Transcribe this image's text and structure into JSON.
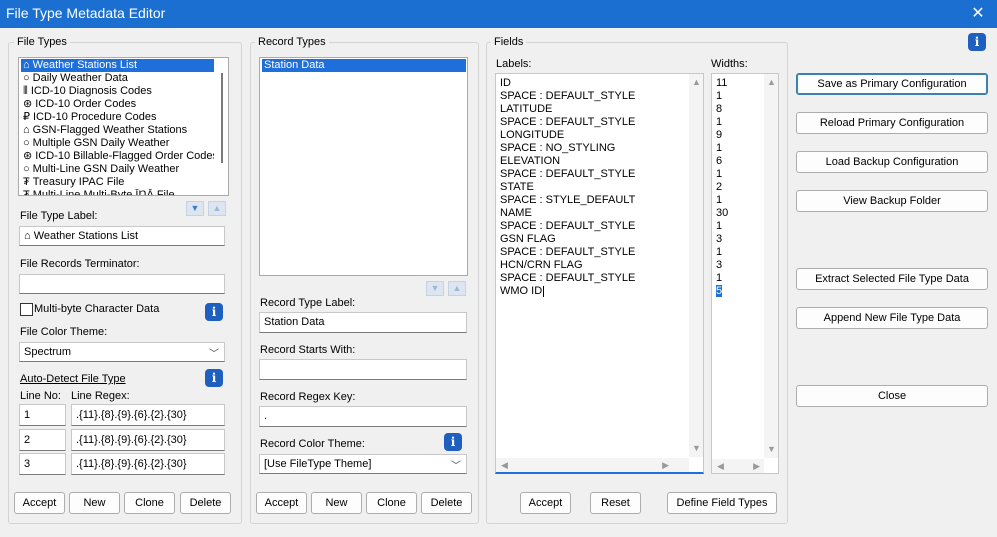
{
  "window": {
    "title": "File Type Metadata Editor",
    "close_glyph": "✕"
  },
  "file_types": {
    "group_label": "File Types",
    "items": [
      {
        "icon": "⌂",
        "label": "Weather Stations List",
        "selected": true
      },
      {
        "icon": "○",
        "label": "Daily Weather Data"
      },
      {
        "icon": "⦀",
        "label": "ICD-10 Diagnosis Codes"
      },
      {
        "icon": "⊛",
        "label": "ICD-10 Order Codes"
      },
      {
        "icon": "₽",
        "label": "ICD-10 Procedure Codes"
      },
      {
        "icon": "⌂",
        "label": "GSN-Flagged Weather Stations"
      },
      {
        "icon": "○",
        "label": "Multiple GSN Daily Weather"
      },
      {
        "icon": "⊛",
        "label": "ICD-10 Billable-Flagged Order Codes"
      },
      {
        "icon": "○",
        "label": "Multi-Line GSN Daily Weather"
      },
      {
        "icon": "₮",
        "label": "Treasury IPAC File"
      },
      {
        "icon": "₮",
        "label": "Multi-Line Multi-Byte ĪŊĀ File"
      }
    ],
    "label_caption": "File Type Label:",
    "label_value": "⌂ Weather Stations List",
    "terminator_caption": "File Records Terminator:",
    "terminator_value": "",
    "multibyte_label": "Multi-byte Character Data",
    "color_theme_caption": "File Color Theme:",
    "color_theme_value": "Spectrum",
    "auto_detect_label": "Auto-Detect File Type",
    "line_no_caption": "Line No:",
    "line_regex_caption": "Line Regex:",
    "rows": [
      {
        "no": "1",
        "regex": ".{11}.{8}.{9}.{6}.{2}.{30}"
      },
      {
        "no": "2",
        "regex": ".{11}.{8}.{9}.{6}.{2}.{30}"
      },
      {
        "no": "3",
        "regex": ".{11}.{8}.{9}.{6}.{2}.{30}"
      }
    ],
    "buttons": {
      "accept": "Accept",
      "new": "New",
      "clone": "Clone",
      "delete": "Delete"
    }
  },
  "record_types": {
    "group_label": "Record Types",
    "items": [
      {
        "label": "Station Data",
        "selected": true
      }
    ],
    "label_caption": "Record Type Label:",
    "label_value": "Station Data",
    "starts_with_caption": "Record Starts With:",
    "starts_with_value": "",
    "regex_key_caption": "Record Regex Key:",
    "regex_key_value": ".",
    "color_theme_caption": "Record Color Theme:",
    "color_theme_value": "[Use FileType Theme]",
    "buttons": {
      "accept": "Accept",
      "new": "New",
      "clone": "Clone",
      "delete": "Delete"
    }
  },
  "fields": {
    "group_label": "Fields",
    "labels_caption": "Labels:",
    "widths_caption": "Widths:",
    "labels": [
      "ID",
      "SPACE : DEFAULT_STYLE",
      "LATITUDE",
      "SPACE : DEFAULT_STYLE",
      "LONGITUDE",
      "SPACE : NO_STYLING",
      "ELEVATION",
      "SPACE : DEFAULT_STYLE",
      "STATE",
      "SPACE : STYLE_DEFAULT",
      "NAME",
      "SPACE : DEFAULT_STYLE",
      "GSN FLAG",
      "SPACE : DEFAULT_STYLE",
      "HCN/CRN FLAG",
      "SPACE : DEFAULT_STYLE",
      "WMO ID"
    ],
    "widths": [
      "11",
      "1",
      "8",
      "1",
      "9",
      "1",
      "6",
      "1",
      "2",
      "1",
      "30",
      "1",
      "3",
      "1",
      "3",
      "1",
      "5"
    ],
    "buttons": {
      "accept": "Accept",
      "reset": "Reset",
      "define": "Define Field Types"
    }
  },
  "actions": {
    "save_primary": "Save as Primary Configuration",
    "reload_primary": "Reload Primary Configuration",
    "load_backup": "Load Backup Configuration",
    "view_backup": "View Backup Folder",
    "extract": "Extract Selected File Type Data",
    "append": "Append New File Type Data",
    "close": "Close"
  },
  "info_glyph": "i",
  "colors": {
    "titlebar": "#1a6fd1",
    "selection": "#1e6fd9",
    "info": "#1f5fbf"
  }
}
